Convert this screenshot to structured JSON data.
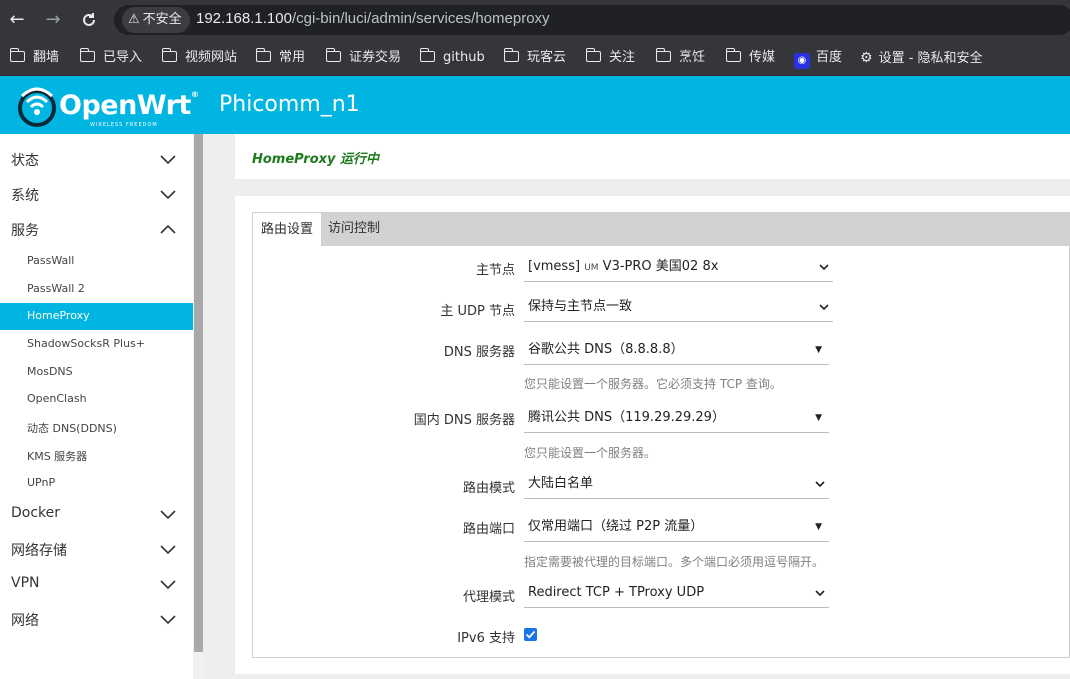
{
  "browser": {
    "security_label": "不安全",
    "url_host": "192.168.1.100",
    "url_path": "/cgi-bin/luci/admin/services/homeproxy",
    "bookmarks": [
      {
        "label": "翻墙",
        "icon": "folder-icon"
      },
      {
        "label": "已导入",
        "icon": "folder-icon"
      },
      {
        "label": "视频网站",
        "icon": "folder-icon"
      },
      {
        "label": "常用",
        "icon": "folder-icon"
      },
      {
        "label": "证券交易",
        "icon": "folder-icon"
      },
      {
        "label": "github",
        "icon": "folder-icon"
      },
      {
        "label": "玩客云",
        "icon": "folder-icon"
      },
      {
        "label": "关注",
        "icon": "folder-icon"
      },
      {
        "label": "烹饪",
        "icon": "folder-icon"
      },
      {
        "label": "传媒",
        "icon": "folder-icon"
      },
      {
        "label": "百度",
        "icon": "baidu-icon"
      },
      {
        "label": "设置 - 隐私和安全",
        "icon": "gear-icon"
      }
    ]
  },
  "header": {
    "logo_text": "OpenWrt",
    "logo_tagline": "WIRELESS FREEDOM",
    "hostname": "Phicomm_n1",
    "brand_color": "#00b5e2"
  },
  "sidebar": {
    "sections_top": [
      {
        "label": "状态",
        "expanded": false
      },
      {
        "label": "系统",
        "expanded": false
      },
      {
        "label": "服务",
        "expanded": true
      }
    ],
    "services": [
      {
        "label": "PassWall",
        "active": false
      },
      {
        "label": "PassWall 2",
        "active": false
      },
      {
        "label": "HomeProxy",
        "active": true
      },
      {
        "label": "ShadowSocksR Plus+",
        "active": false
      },
      {
        "label": "MosDNS",
        "active": false
      },
      {
        "label": "OpenClash",
        "active": false
      },
      {
        "label": "动态 DNS(DDNS)",
        "active": false
      },
      {
        "label": "KMS 服务器",
        "active": false
      },
      {
        "label": "UPnP",
        "active": false
      }
    ],
    "sections_bottom": [
      {
        "label": "Docker",
        "expanded": false
      },
      {
        "label": "网络存储",
        "expanded": false
      },
      {
        "label": "VPN",
        "expanded": false
      },
      {
        "label": "网络",
        "expanded": false
      }
    ]
  },
  "status": {
    "text": "HomeProxy 运行中",
    "color": "#1e7a1e"
  },
  "tabs": [
    {
      "label": "路由设置",
      "active": true
    },
    {
      "label": "访问控制",
      "active": false
    }
  ],
  "form": {
    "main_node": {
      "label": "主节点",
      "value_prefix": "[vmess] ",
      "value_flag": "UM",
      "value_rest": " V3-PRO 美国02 8x"
    },
    "main_udp_node": {
      "label": "主 UDP 节点",
      "value": "保持与主节点一致"
    },
    "dns_server": {
      "label": "DNS 服务器",
      "value": "谷歌公共 DNS（8.8.8.8）",
      "desc": "您只能设置一个服务器。它必须支持 TCP 查询。"
    },
    "china_dns_server": {
      "label": "国内 DNS 服务器",
      "value": "腾讯公共 DNS（119.29.29.29）",
      "desc": "您只能设置一个服务器。"
    },
    "routing_mode": {
      "label": "路由模式",
      "value": "大陆白名单"
    },
    "routing_port": {
      "label": "路由端口",
      "value": "仅常用端口（绕过 P2P 流量）",
      "desc": "指定需要被代理的目标端口。多个端口必须用逗号隔开。"
    },
    "proxy_mode": {
      "label": "代理模式",
      "value": "Redirect TCP + TProxy UDP"
    },
    "ipv6_support": {
      "label": "IPv6 支持",
      "checked": true
    }
  }
}
